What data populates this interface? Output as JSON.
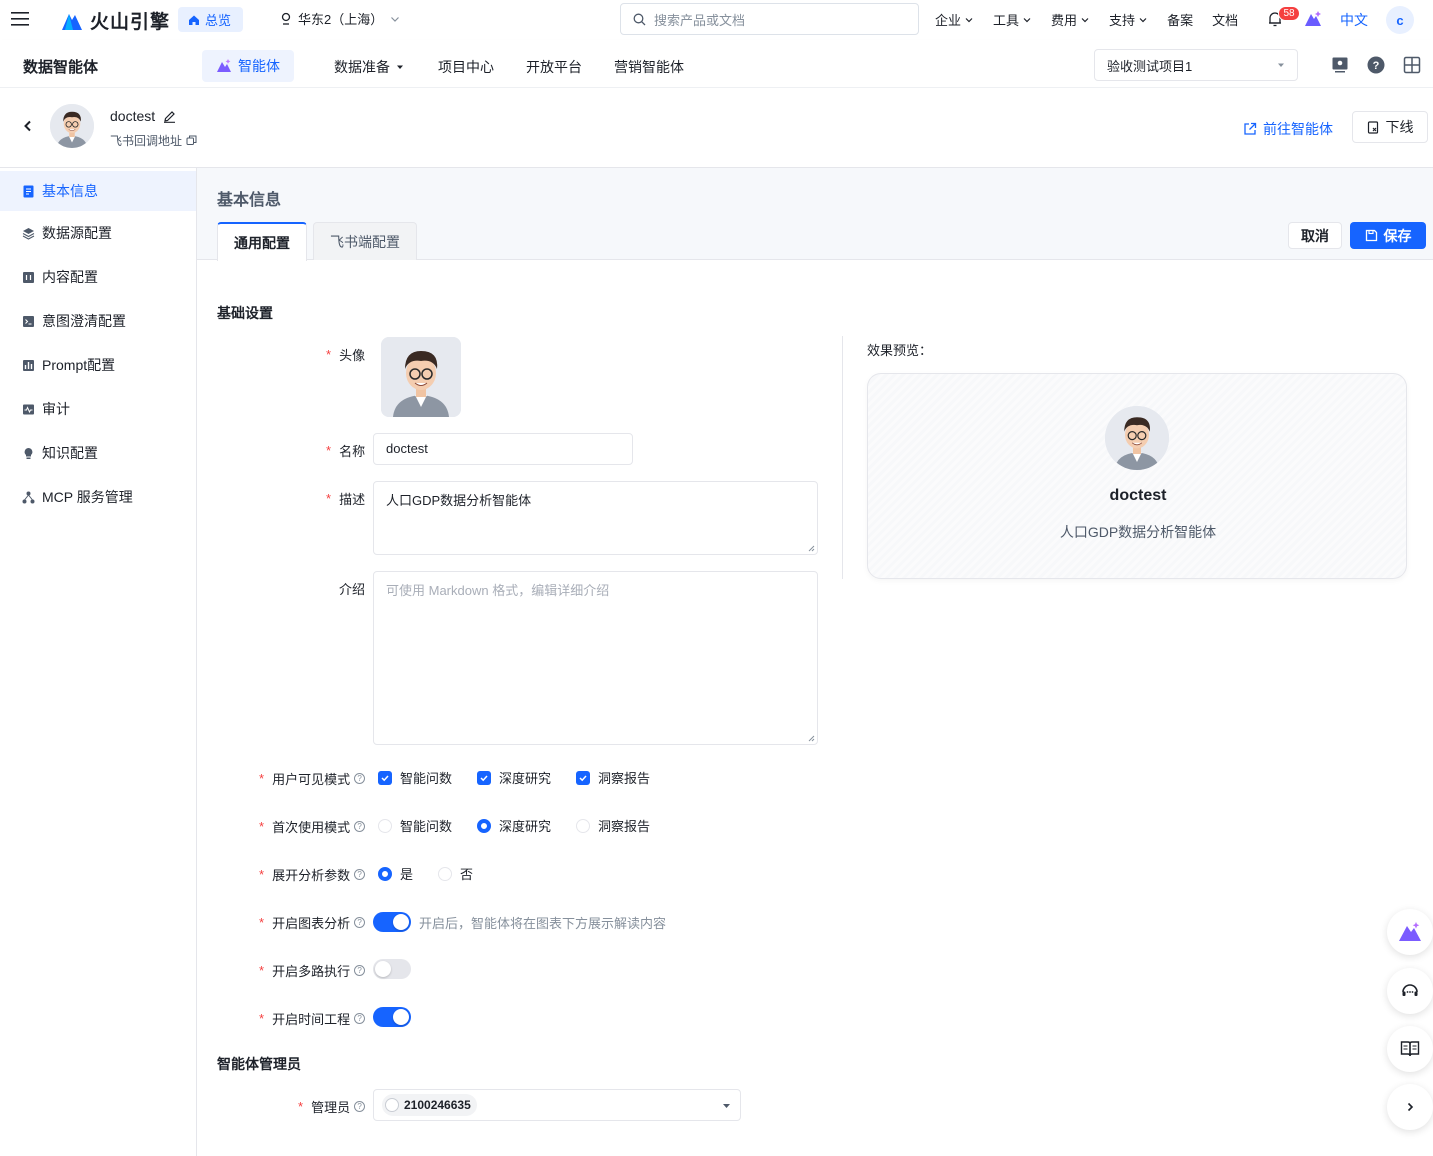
{
  "topbar": {
    "brand": "火山引擎",
    "overview": "总览",
    "region": "华东2（上海）",
    "search_placeholder": "搜索产品或文档",
    "nav": [
      {
        "label": "企业",
        "dropdown": true
      },
      {
        "label": "工具",
        "dropdown": true
      },
      {
        "label": "费用",
        "dropdown": true
      },
      {
        "label": "支持",
        "dropdown": true
      },
      {
        "label": "备案",
        "dropdown": false
      },
      {
        "label": "文档",
        "dropdown": false
      }
    ],
    "notification_count": "58",
    "language": "中文",
    "user_initial": "c"
  },
  "subbar": {
    "product": "数据智能体",
    "active": "智能体",
    "items": [
      "数据准备",
      "项目中心",
      "开放平台",
      "营销智能体"
    ],
    "project": "验收测试项目1"
  },
  "agent": {
    "name": "doctest",
    "callback_label": "飞书回调地址",
    "goto": "前往智能体",
    "offline": "下线"
  },
  "sidebar": {
    "items": [
      {
        "label": "基本信息",
        "icon": "doc-icon",
        "active": true
      },
      {
        "label": "数据源配置",
        "icon": "layers-icon",
        "active": false
      },
      {
        "label": "内容配置",
        "icon": "content-icon",
        "active": false
      },
      {
        "label": "意图澄清配置",
        "icon": "terminal-icon",
        "active": false
      },
      {
        "label": "Prompt配置",
        "icon": "bar-chart-icon",
        "active": false
      },
      {
        "label": "审计",
        "icon": "pulse-icon",
        "active": false
      },
      {
        "label": "知识配置",
        "icon": "bulb-icon",
        "active": false
      },
      {
        "label": "MCP 服务管理",
        "icon": "network-icon",
        "active": false
      }
    ]
  },
  "content": {
    "title": "基本信息",
    "tabs": [
      "通用配置",
      "飞书端配置"
    ],
    "cancel": "取消",
    "save": "保存",
    "basic_section": "基础设置",
    "admin_section": "智能体管理员"
  },
  "form": {
    "avatar_label": "头像",
    "name_label": "名称",
    "name_value": "doctest",
    "desc_label": "描述",
    "desc_value": "人口GDP数据分析智能体",
    "intro_label": "介绍",
    "intro_placeholder": "可使用 Markdown 格式，编辑详细介绍",
    "visible_modes_label": "用户可见模式",
    "visible_modes": [
      "智能问数",
      "深度研究",
      "洞察报告"
    ],
    "first_mode_label": "首次使用模式",
    "first_modes": [
      "智能问数",
      "深度研究",
      "洞察报告"
    ],
    "first_mode_selected": "深度研究",
    "expand_label": "展开分析参数",
    "expand_options": [
      "是",
      "否"
    ],
    "expand_selected": "是",
    "chart_analysis_label": "开启图表分析",
    "chart_analysis_on": true,
    "chart_analysis_hint": "开启后，智能体将在图表下方展示解读内容",
    "multipath_label": "开启多路执行",
    "multipath_on": false,
    "time_eng_label": "开启时间工程",
    "time_eng_on": true,
    "admin_label": "管理员",
    "admin_value": "2100246635"
  },
  "preview": {
    "label": "效果预览：",
    "name": "doctest",
    "desc": "人口GDP数据分析智能体"
  },
  "colors": {
    "primary": "#1664ff",
    "danger": "#f53f3f"
  }
}
